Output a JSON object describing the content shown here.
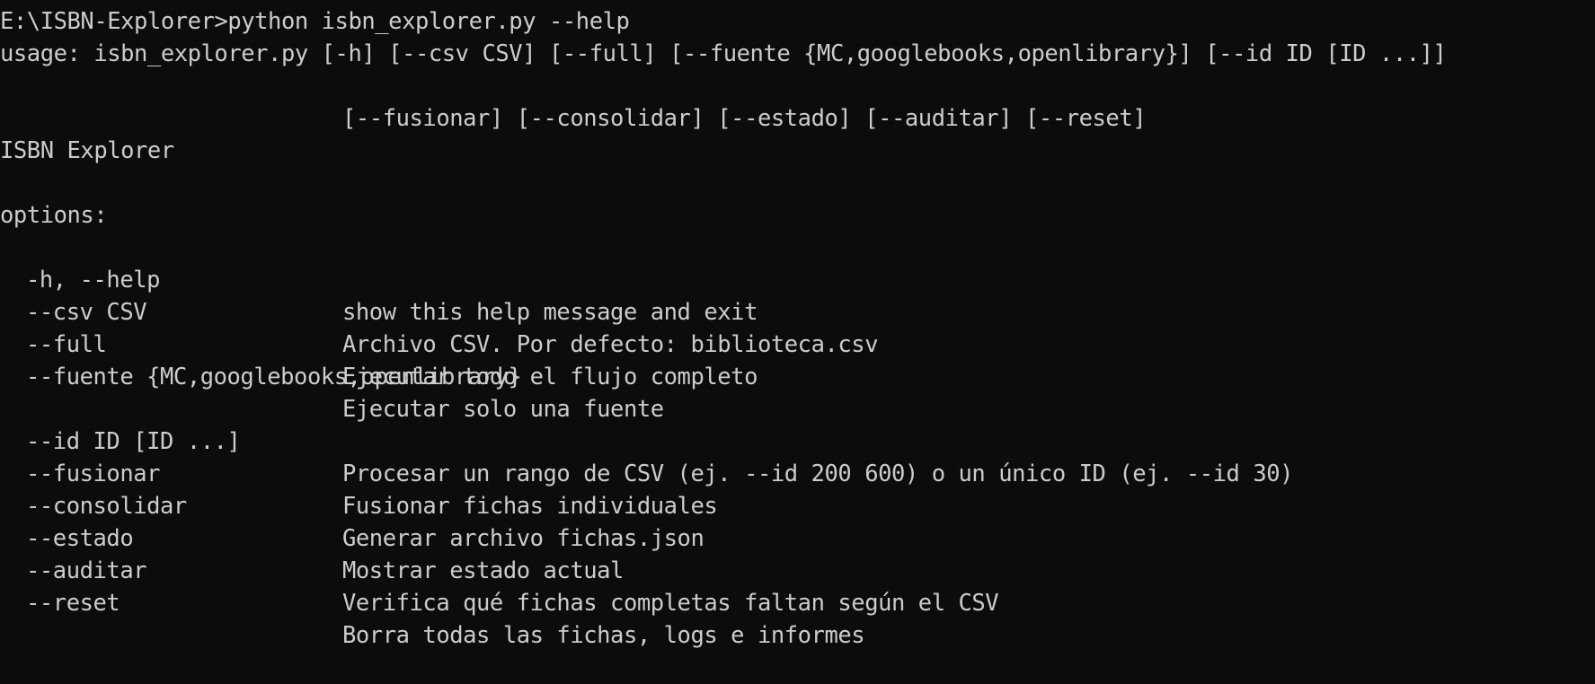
{
  "terminal": {
    "prompt_line": "E:\\ISBN-Explorer>python isbn_explorer.py --help",
    "usage_line_1": "usage: isbn_explorer.py [-h] [--csv CSV] [--full] [--fuente {MC,googlebooks,openlibrary}] [--id ID [ID ...]]",
    "usage_line_2": "[--fusionar] [--consolidar] [--estado] [--auditar] [--reset]",
    "description": "ISBN Explorer",
    "options_header": "options:",
    "options": [
      {
        "flag": "-h, --help",
        "desc": "show this help message and exit"
      },
      {
        "flag": "--csv CSV",
        "desc": "Archivo CSV. Por defecto: biblioteca.csv"
      },
      {
        "flag": "--full",
        "desc": "Ejecutar todo el flujo completo"
      },
      {
        "flag": "--fuente {MC,googlebooks,openlibrary}",
        "desc": "Ejecutar solo una fuente"
      },
      {
        "flag": "--id ID [ID ...]",
        "desc": "Procesar un rango de CSV (ej. --id 200 600) o un único ID (ej. --id 30)"
      },
      {
        "flag": "--fusionar",
        "desc": "Fusionar fichas individuales"
      },
      {
        "flag": "--consolidar",
        "desc": "Generar archivo fichas.json"
      },
      {
        "flag": "--estado",
        "desc": "Mostrar estado actual"
      },
      {
        "flag": "--auditar",
        "desc": "Verifica qué fichas completas faltan según el CSV"
      },
      {
        "flag": "--reset",
        "desc": "Borra todas las fichas, logs e informes"
      }
    ]
  },
  "colors": {
    "background": "#0c0c0c",
    "text": "#cccccc"
  }
}
